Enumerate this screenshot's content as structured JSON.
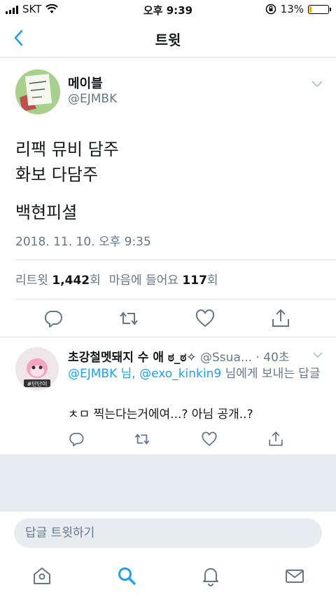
{
  "status_bar": {
    "carrier": "SKT",
    "time": "오후 9:39",
    "battery": "13%",
    "battery_level": 0.13
  },
  "nav": {
    "title": "트윗"
  },
  "tweet": {
    "name": "메이블",
    "handle": "@EJMBK",
    "text_lines": "리팩 뮤비 담주\n화보 다담주",
    "text_extra": "백현피셜",
    "timestamp": "2018. 11. 10. 오후 9:35",
    "retweet_label": "리트윗",
    "retweet_count": "1,442",
    "count_unit": "회",
    "like_label": "마음에 들어요",
    "like_count": "117"
  },
  "reply": {
    "name": "초강철멧돼지 수 애 ಠ_ಠ✧",
    "handle": "@Ssua...",
    "time": "· 40초",
    "mention1": "@EJMBK",
    "separator1": " 님, ",
    "mention2": "@exo_kinkin9",
    "separator2": " 님에게 보내는 답글",
    "text": "ㅊㅁ 찍는다는거에여...? 아님 공개..?",
    "avatar_tag": "#단단이"
  },
  "compose": {
    "placeholder": "답글 트윗하기"
  },
  "tabs": [
    "home",
    "search",
    "notifications",
    "messages"
  ],
  "colors": {
    "accent": "#1da1f2",
    "secondary_text": "#657786",
    "gray_bg": "#e6ecf0"
  }
}
